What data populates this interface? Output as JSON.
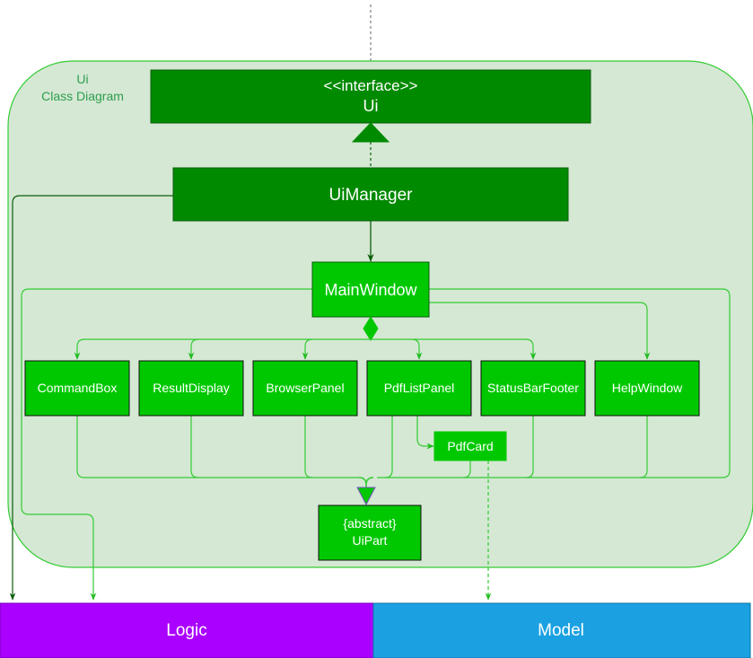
{
  "diagram": {
    "package": {
      "title_line1": "Ui",
      "title_line2": "Class Diagram"
    },
    "interface_ui": {
      "stereotype": "<<interface>>",
      "name": "Ui"
    },
    "ui_manager": {
      "name": "UiManager"
    },
    "main_window": {
      "name": "MainWindow"
    },
    "components": [
      {
        "name": "CommandBox"
      },
      {
        "name": "ResultDisplay"
      },
      {
        "name": "BrowserPanel"
      },
      {
        "name": "PdfListPanel"
      },
      {
        "name": "StatusBarFooter"
      },
      {
        "name": "HelpWindow"
      }
    ],
    "pdf_card": {
      "name": "PdfCard"
    },
    "ui_part": {
      "stereotype": "{abstract}",
      "name": "UiPart"
    },
    "external": {
      "logic": "Logic",
      "model": "Model"
    },
    "colors": {
      "package_fill": "#d5e8d4",
      "package_border": "#33cc33",
      "dark_green": "#008a00",
      "bright_green": "#00c800",
      "line_green": "#33cc33",
      "logic_purple": "#aa00ff",
      "model_blue": "#1ba1e2",
      "title_text": "#2e9e4e"
    }
  }
}
